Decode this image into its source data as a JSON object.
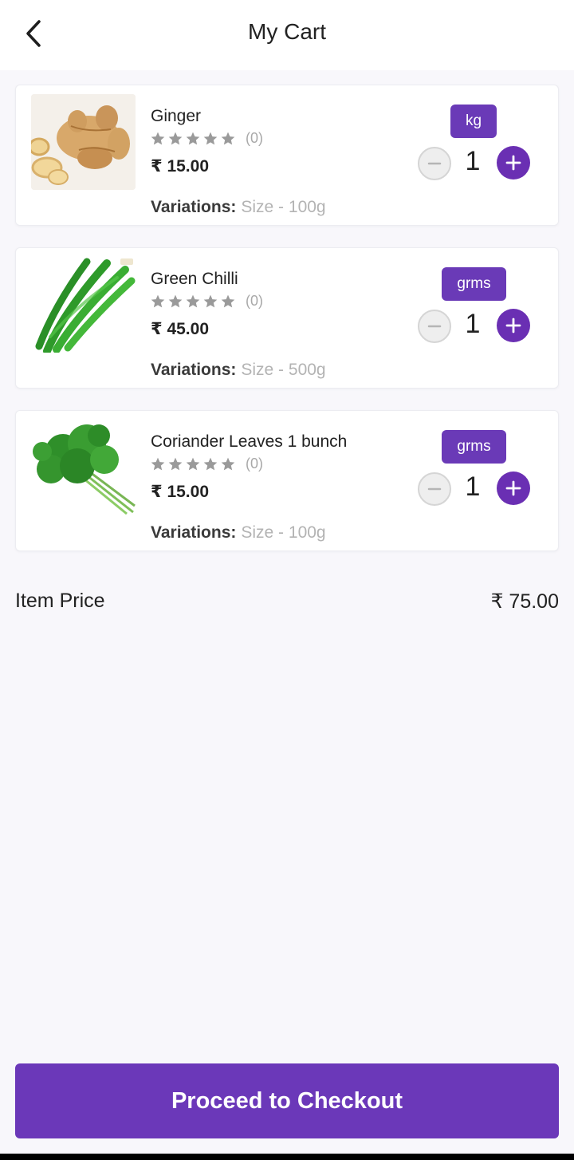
{
  "header": {
    "title": "My Cart",
    "back_icon": "chevron-left-icon"
  },
  "cart": {
    "items": [
      {
        "name": "Ginger",
        "rating_count": "(0)",
        "price": "₹ 15.00",
        "variations_label": "Variations:",
        "variations_value": "Size - 100g",
        "unit": "kg",
        "quantity": "1",
        "stars_filled": 0
      },
      {
        "name": "Green Chilli",
        "rating_count": "(0)",
        "price": "₹ 45.00",
        "variations_label": "Variations:",
        "variations_value": "Size - 500g",
        "unit": "grms",
        "quantity": "1",
        "stars_filled": 0
      },
      {
        "name": "Coriander Leaves 1 bunch",
        "rating_count": "(0)",
        "price": "₹ 15.00",
        "variations_label": "Variations:",
        "variations_value": "Size - 100g",
        "unit": "grms",
        "quantity": "1",
        "stars_filled": 0
      }
    ]
  },
  "summary": {
    "item_price_label": "Item Price",
    "item_price_value": "₹ 75.00"
  },
  "checkout": {
    "label": "Proceed to Checkout"
  },
  "colors": {
    "accent": "#6b38b9",
    "star": "#9a9a9a",
    "background": "#f8f7fb"
  }
}
